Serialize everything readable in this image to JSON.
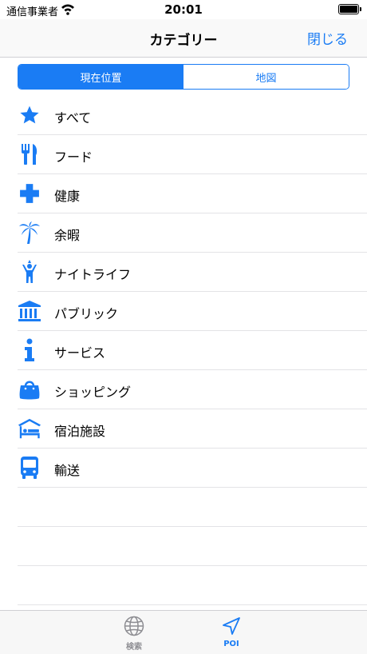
{
  "status": {
    "carrier": "通信事業者",
    "time": "20:01"
  },
  "nav": {
    "title": "カテゴリー",
    "close": "閉じる"
  },
  "segments": [
    "現在位置",
    "地図"
  ],
  "categories": [
    {
      "label": "すべて",
      "icon": "star-icon"
    },
    {
      "label": "フード",
      "icon": "fork-knife-icon"
    },
    {
      "label": "健康",
      "icon": "cross-icon"
    },
    {
      "label": "余暇",
      "icon": "palm-tree-icon"
    },
    {
      "label": "ナイトライフ",
      "icon": "person-light-icon"
    },
    {
      "label": "パブリック",
      "icon": "building-columns-icon"
    },
    {
      "label": "サービス",
      "icon": "info-icon"
    },
    {
      "label": "ショッピング",
      "icon": "shopping-bag-icon"
    },
    {
      "label": "宿泊施設",
      "icon": "bed-icon"
    },
    {
      "label": "輸送",
      "icon": "bus-icon"
    }
  ],
  "tabs": [
    {
      "label": "検索",
      "icon": "globe-icon"
    },
    {
      "label": "POI",
      "icon": "location-arrow-icon"
    }
  ],
  "colors": {
    "accent": "#1a7cf4",
    "inactive": "#8e8e93"
  }
}
